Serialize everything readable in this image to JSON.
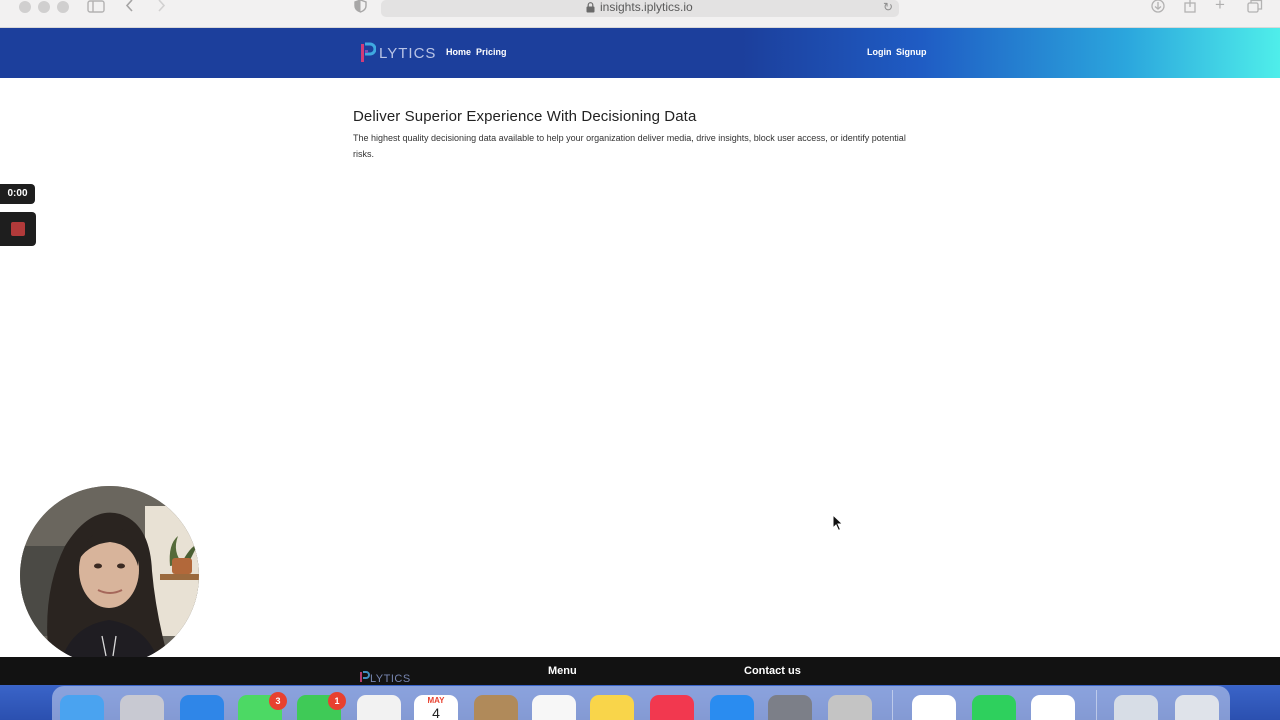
{
  "browser": {
    "url": "insights.iplytics.io"
  },
  "header": {
    "logo_text": "LYTICS",
    "nav": [
      "Home",
      "Pricing"
    ],
    "auth": [
      "Login",
      "Signup"
    ]
  },
  "hero": {
    "title": "Deliver Superior Experience With Decisioning Data",
    "description": "The highest quality decisioning data available to help your organization deliver media, drive insights, block user access, or identify potential risks."
  },
  "recorder": {
    "timer": "0:00"
  },
  "footer": {
    "logo_text": "LYTICS",
    "menu_label": "Menu",
    "contact_label": "Contact us"
  },
  "dock": {
    "items": [
      {
        "icon": "finder-icon",
        "color": "#4aa3f0"
      },
      {
        "icon": "launchpad-icon",
        "color": "#c8c9d2"
      },
      {
        "icon": "safari-icon",
        "color": "#2f86e8"
      },
      {
        "icon": "messages-icon",
        "color": "#4cd964",
        "badge": "3"
      },
      {
        "icon": "facetime-icon",
        "color": "#3fca57",
        "badge": "1"
      },
      {
        "icon": "photos-icon",
        "color": "#f2f2f2"
      },
      {
        "icon": "calendar-icon",
        "color": "#ffffff",
        "month": "MAY",
        "day": "4"
      },
      {
        "icon": "contacts-icon",
        "color": "#b08a5a"
      },
      {
        "icon": "reminders-icon",
        "color": "#f7f7f7"
      },
      {
        "icon": "notes-icon",
        "color": "#f9d54a"
      },
      {
        "icon": "music-icon",
        "color": "#f2384f"
      },
      {
        "icon": "app-store-icon",
        "color": "#2a8cf0"
      },
      {
        "icon": "system-preferences-icon",
        "color": "#7c7f88"
      },
      {
        "icon": "calculator-icon",
        "color": "#c4c4c4"
      },
      {
        "icon": "slack-icon",
        "color": "#ffffff"
      },
      {
        "icon": "whatsapp-icon",
        "color": "#2ed05d"
      },
      {
        "icon": "chrome-icon",
        "color": "#ffffff"
      },
      {
        "icon": "preview-icon",
        "color": "#d7dde6"
      },
      {
        "icon": "trash-icon",
        "color": "#dfe3ea"
      }
    ]
  }
}
